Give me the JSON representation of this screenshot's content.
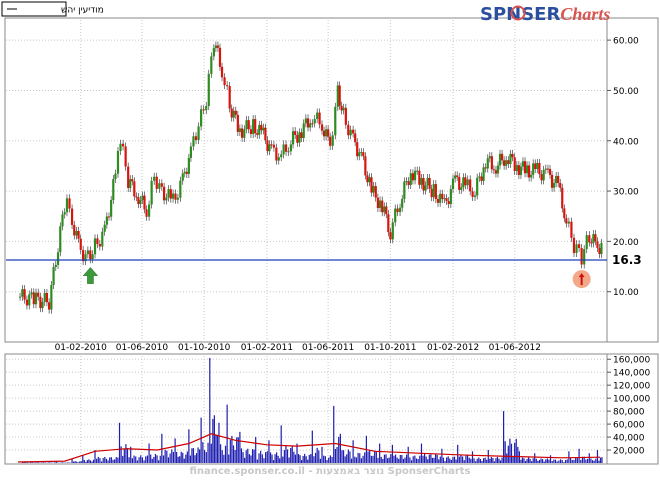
{
  "legend": {
    "label": "מודיעין יהש"
  },
  "brand": {
    "part1": "SP",
    "part2": "NSER",
    "part3": "Charts",
    "accent": "#d9534f",
    "primary": "#2b4f9e"
  },
  "watermark": "finance.sponser.co.il - נוצר באמצעות SponserCharts",
  "colors": {
    "up": "#2e8b22",
    "down": "#d9140d",
    "volume": "#1d1db0",
    "volume_ma": "#cc0000",
    "level_line": "#1f3fb8",
    "grid": "#c8c8c8"
  },
  "chart_data": [
    {
      "type": "candlestick",
      "x_ticks": [
        "01-02-2010",
        "01-06-2010",
        "01-10-2010",
        "01-02-2011",
        "01-06-2011",
        "01-10-2011",
        "01-02-2012",
        "01-06-2012"
      ],
      "y_ticks": [
        "10.00",
        "20.00",
        "30.00",
        "40.00",
        "50.00",
        "60.00"
      ],
      "ylim": [
        0,
        64
      ],
      "x_range": [
        "2009-10-01",
        "2012-11-15"
      ],
      "horizontal_line": {
        "value": 16.3,
        "label": "16.3"
      },
      "markers": [
        {
          "type": "arrow-up",
          "color": "#3c9a3c",
          "date": "2010-02-20",
          "value": 13
        },
        {
          "type": "arrow-up-circle",
          "color": "#f4a88a",
          "date": "2012-10-10",
          "value": 12.5
        }
      ],
      "series": [
        {
          "values": [
            [
              "2009-10-05",
              9.0
            ],
            [
              "2009-11-01",
              8.5
            ],
            [
              "2009-12-01",
              8.0
            ],
            [
              "2010-01-05",
              30.0
            ],
            [
              "2010-01-15",
              24.0
            ],
            [
              "2010-02-01",
              18.0
            ],
            [
              "2010-02-15",
              17.0
            ],
            [
              "2010-03-01",
              19.0
            ],
            [
              "2010-03-20",
              22.0
            ],
            [
              "2010-04-10",
              33.0
            ],
            [
              "2010-04-20",
              40.0
            ],
            [
              "2010-05-05",
              32.0
            ],
            [
              "2010-05-25",
              29.0
            ],
            [
              "2010-06-10",
              26.0
            ],
            [
              "2010-06-25",
              33.0
            ],
            [
              "2010-07-10",
              30.0
            ],
            [
              "2010-08-01",
              28.0
            ],
            [
              "2010-08-20",
              32.0
            ],
            [
              "2010-09-05",
              38.0
            ],
            [
              "2010-09-20",
              43.0
            ],
            [
              "2010-10-05",
              48.0
            ],
            [
              "2010-10-20",
              60.0
            ],
            [
              "2010-11-05",
              54.0
            ],
            [
              "2010-11-20",
              47.0
            ],
            [
              "2010-12-10",
              42.0
            ],
            [
              "2011-01-05",
              43.0
            ],
            [
              "2011-01-25",
              41.0
            ],
            [
              "2011-02-10",
              38.0
            ],
            [
              "2011-03-01",
              37.0
            ],
            [
              "2011-03-20",
              40.0
            ],
            [
              "2011-04-10",
              42.0
            ],
            [
              "2011-05-01",
              45.0
            ],
            [
              "2011-05-20",
              43.0
            ],
            [
              "2011-06-05",
              39.0
            ],
            [
              "2011-06-20",
              50.0
            ],
            [
              "2011-07-01",
              45.0
            ],
            [
              "2011-07-20",
              40.0
            ],
            [
              "2011-08-05",
              37.0
            ],
            [
              "2011-08-25",
              30.0
            ],
            [
              "2011-09-15",
              27.0
            ],
            [
              "2011-10-01",
              22.0
            ],
            [
              "2011-10-20",
              28.0
            ],
            [
              "2011-11-10",
              34.0
            ],
            [
              "2011-12-01",
              32.0
            ],
            [
              "2011-12-25",
              30.0
            ],
            [
              "2012-01-15",
              27.0
            ],
            [
              "2012-02-05",
              32.0
            ],
            [
              "2012-02-25",
              31.0
            ],
            [
              "2012-03-15",
              30.0
            ],
            [
              "2012-04-05",
              36.0
            ],
            [
              "2012-04-25",
              35.0
            ],
            [
              "2012-05-15",
              37.0
            ],
            [
              "2012-06-05",
              35.0
            ],
            [
              "2012-06-25",
              34.0
            ],
            [
              "2012-07-15",
              34.0
            ],
            [
              "2012-08-05",
              33.0
            ],
            [
              "2012-08-25",
              31.0
            ],
            [
              "2012-09-10",
              24.0
            ],
            [
              "2012-09-25",
              19.0
            ],
            [
              "2012-10-10",
              17.0
            ],
            [
              "2012-10-25",
              21.0
            ],
            [
              "2012-11-10",
              19.0
            ]
          ]
        }
      ]
    },
    {
      "type": "bar",
      "y_ticks": [
        "20,000",
        "40,000",
        "60,000",
        "80,000",
        "100,000",
        "120,000",
        "140,000",
        "160,000"
      ],
      "ylim": [
        0,
        165000
      ],
      "x_range": [
        "2009-10-01",
        "2012-11-15"
      ],
      "series": [
        {
          "values": [
            [
              "2009-10-10",
              2000
            ],
            [
              "2009-12-15",
              2000
            ],
            [
              "2010-01-15",
              6000
            ],
            [
              "2010-02-05",
              12000
            ],
            [
              "2010-03-01",
              20000
            ],
            [
              "2010-04-18",
              62000
            ],
            [
              "2010-05-10",
              25000
            ],
            [
              "2010-06-15",
              30000
            ],
            [
              "2010-07-10",
              45000
            ],
            [
              "2010-08-05",
              38000
            ],
            [
              "2010-09-01",
              52000
            ],
            [
              "2010-09-25",
              70000
            ],
            [
              "2010-10-12",
              162000
            ],
            [
              "2010-10-30",
              62000
            ],
            [
              "2010-11-15",
              90000
            ],
            [
              "2010-12-10",
              48000
            ],
            [
              "2011-01-10",
              40000
            ],
            [
              "2011-02-05",
              35000
            ],
            [
              "2011-03-01",
              58000
            ],
            [
              "2011-04-01",
              30000
            ],
            [
              "2011-05-01",
              50000
            ],
            [
              "2011-05-20",
              25000
            ],
            [
              "2011-06-12",
              88000
            ],
            [
              "2011-06-25",
              45000
            ],
            [
              "2011-07-20",
              35000
            ],
            [
              "2011-08-15",
              42000
            ],
            [
              "2011-09-10",
              30000
            ],
            [
              "2011-10-05",
              28000
            ],
            [
              "2011-11-05",
              25000
            ],
            [
              "2011-12-01",
              30000
            ],
            [
              "2012-01-10",
              22000
            ],
            [
              "2012-02-10",
              28000
            ],
            [
              "2012-03-10",
              18000
            ],
            [
              "2012-04-10",
              20000
            ],
            [
              "2012-05-10",
              80000
            ],
            [
              "2012-06-10",
              18000
            ],
            [
              "2012-07-10",
              15000
            ],
            [
              "2012-08-10",
              12000
            ],
            [
              "2012-09-15",
              18000
            ],
            [
              "2012-10-05",
              22000
            ],
            [
              "2012-10-25",
              15000
            ],
            [
              "2012-11-10",
              20000
            ]
          ]
        },
        {
          "name": "ma",
          "values": [
            [
              "2009-10-01",
              1500
            ],
            [
              "2010-01-01",
              3000
            ],
            [
              "2010-03-01",
              18000
            ],
            [
              "2010-05-01",
              22000
            ],
            [
              "2010-07-01",
              20000
            ],
            [
              "2010-09-01",
              30000
            ],
            [
              "2010-10-15",
              45000
            ],
            [
              "2010-12-01",
              35000
            ],
            [
              "2011-02-01",
              28000
            ],
            [
              "2011-04-01",
              26000
            ],
            [
              "2011-06-15",
              30000
            ],
            [
              "2011-09-01",
              18000
            ],
            [
              "2011-12-01",
              15000
            ],
            [
              "2012-03-01",
              12000
            ],
            [
              "2012-06-01",
              10000
            ],
            [
              "2012-09-01",
              8000
            ],
            [
              "2012-11-15",
              9000
            ]
          ]
        }
      ]
    }
  ]
}
